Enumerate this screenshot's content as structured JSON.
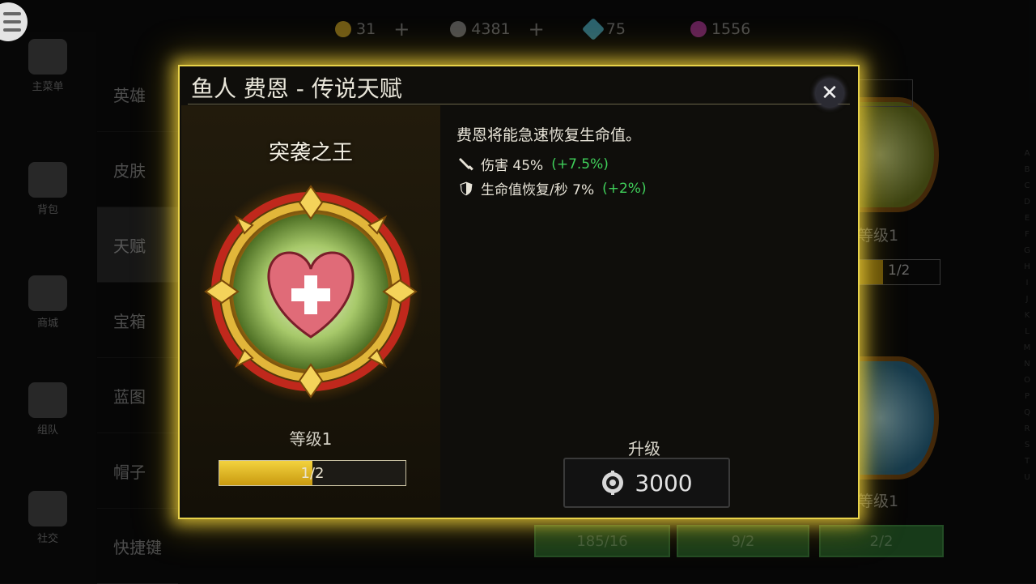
{
  "currency": [
    {
      "icon": "gold-coin-icon",
      "value": "31",
      "has_plus": true,
      "color": "#c9a227"
    },
    {
      "icon": "gear-coin-icon",
      "value": "4381",
      "has_plus": true,
      "color": "#9a9a9a"
    },
    {
      "icon": "gem-icon",
      "value": "75",
      "has_plus": false,
      "color": "#4fb3c9"
    },
    {
      "icon": "crystal-icon",
      "value": "1556",
      "has_plus": false,
      "color": "#b03a9a"
    }
  ],
  "nav": [
    {
      "label": "主菜单",
      "icon": "castle-icon"
    },
    {
      "label": "背包",
      "icon": "backpack-icon"
    },
    {
      "label": "商城",
      "icon": "cart-icon"
    },
    {
      "label": "组队",
      "icon": "team-icon"
    },
    {
      "label": "社交",
      "icon": "social-icon"
    }
  ],
  "categories": [
    "英雄",
    "皮肤",
    "天赋",
    "宝箱",
    "蓝图",
    "帽子",
    "快捷键"
  ],
  "background_cards": {
    "level_top": "等级1",
    "progress_top": "1/2",
    "level_bottom": "等级1",
    "buttons": [
      "185/16",
      "9/2",
      "2/2"
    ]
  },
  "alphabet": [
    "A",
    "B",
    "C",
    "D",
    "E",
    "F",
    "G",
    "H",
    "I",
    "J",
    "K",
    "L",
    "M",
    "N",
    "O",
    "P",
    "Q",
    "R",
    "S",
    "T",
    "U"
  ],
  "modal": {
    "title": "鱼人 费恩 - 传说天赋",
    "close_symbol": "✕",
    "talent_name": "突袭之王",
    "level": "等级1",
    "progress_text": "1/2",
    "progress_fraction": 0.5,
    "description": "费恩将能急速恢复生命值。",
    "stats": [
      {
        "icon": "sword-icon",
        "label": "伤害 45%",
        "bonus": "(+7.5%)"
      },
      {
        "icon": "shield-icon",
        "label": "生命值恢复/秒 7%",
        "bonus": "(+2%)"
      }
    ],
    "upgrade_label": "升级",
    "upgrade_cost": "3000"
  },
  "colors": {
    "accent_gold": "#e8d24a",
    "bonus_green": "#3fcf5a",
    "heart": "#e06b78"
  }
}
